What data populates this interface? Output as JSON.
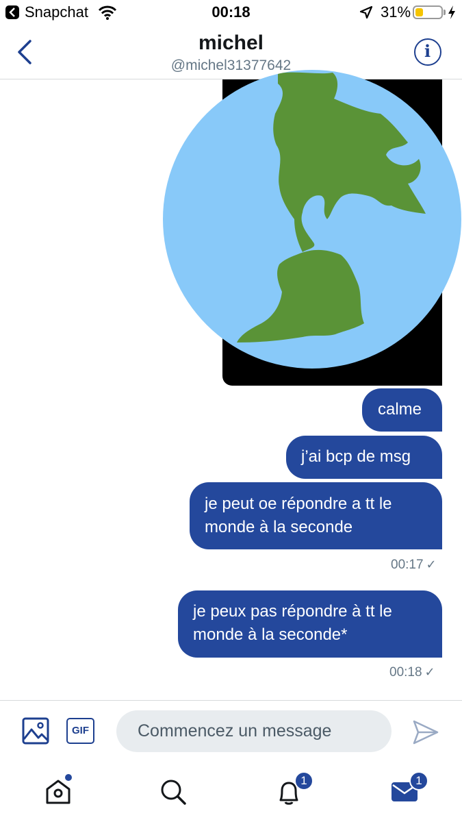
{
  "status_bar": {
    "app_name": "Snapchat",
    "time": "00:18",
    "battery_percent": "31%",
    "battery_level": 0.31,
    "battery_color": "#f5c400"
  },
  "header": {
    "name": "michel",
    "handle": "@michel31377642",
    "back_icon": "chevron-left-icon",
    "info_icon": "info-icon",
    "info_glyph": "i"
  },
  "media": {
    "description_icon": "globe-icon"
  },
  "messages": [
    {
      "text": "calme"
    },
    {
      "text": "j’ai bcp de msg"
    },
    {
      "text": "je peut oe répondre a tt le monde à la seconde",
      "timestamp": "00:17"
    },
    {
      "text": "je peux pas répondre à tt le monde à la seconde*",
      "timestamp": "00:18"
    }
  ],
  "composer": {
    "gif_label": "GIF",
    "placeholder": "Commencez un message",
    "image_icon": "image-icon",
    "send_icon": "send-icon"
  },
  "tabbar": {
    "notifications_badge": "1",
    "messages_badge": "1"
  },
  "colors": {
    "accent": "#1d3f8f",
    "bubble": "#24489c",
    "muted": "#657786"
  }
}
